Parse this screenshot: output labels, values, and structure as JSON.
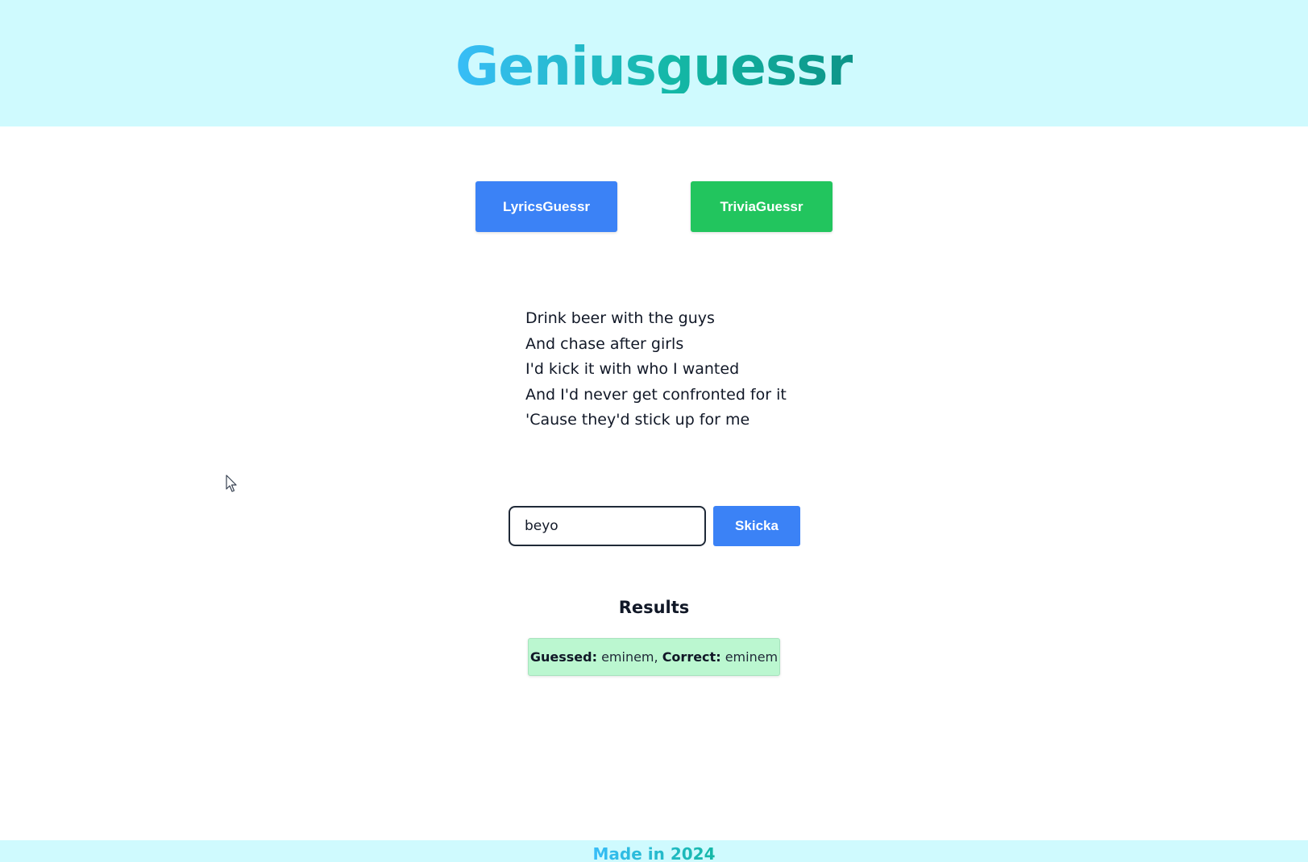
{
  "header": {
    "logo_text": "Geniusguessr"
  },
  "modes": {
    "lyrics_label": "LyricsGuessr",
    "trivia_label": "TriviaGuessr"
  },
  "lyrics": {
    "lines": [
      "Drink beer with the guys",
      "And chase after girls",
      "I'd kick it with who I wanted",
      "And I'd never get confronted for it",
      "'Cause they'd stick up for me"
    ]
  },
  "guess": {
    "input_value": "beyo",
    "submit_label": "Skicka"
  },
  "results": {
    "title": "Results",
    "items": [
      {
        "guessed_label": "Guessed:",
        "guessed_value": "eminem,",
        "correct_label": "Correct:",
        "correct_value": "eminem"
      }
    ]
  },
  "footer": {
    "text": "Made in 2024"
  },
  "colors": {
    "header_bg": "#cffafe",
    "lyrics_button": "#3b82f6",
    "trivia_button": "#22c55e",
    "result_bg": "#bbf7d0"
  }
}
